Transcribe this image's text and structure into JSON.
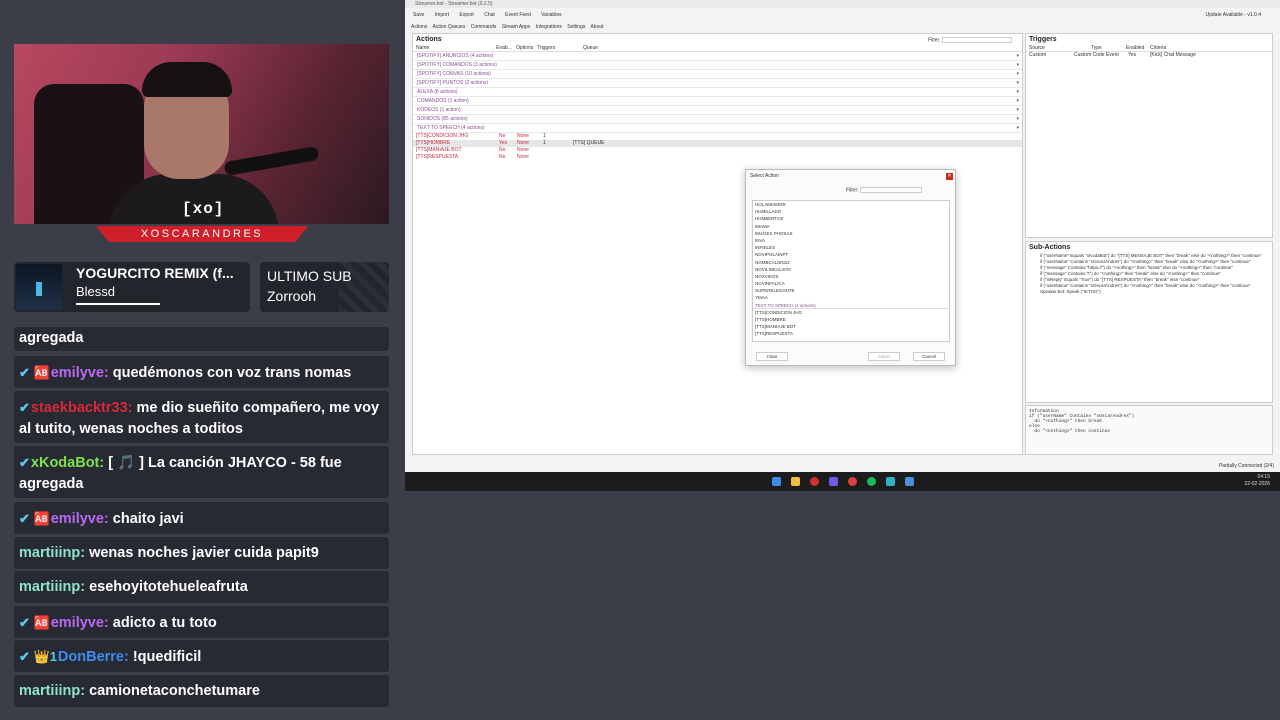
{
  "stream": {
    "channel_name": "XOSCARANDRES",
    "logo_text": "[xo]",
    "song": {
      "title": "YOGURCITO REMIX (f...",
      "artist": "Blessd",
      "progress": 0.5
    },
    "last_sub": {
      "label": "ULTIMO SUB",
      "name": "Zorrooh"
    }
  },
  "chat": [
    {
      "user": "",
      "text": "agregada",
      "icon": "",
      "color": "#ffffff"
    },
    {
      "user": "emilyve:",
      "text": " quedémonos con voz trans nomas",
      "icon": "✔ 🆎",
      "color": "#b86af0"
    },
    {
      "user": "staekbacktr33:",
      "text": " me dio sueñito compañero, me voy al tutito, wenas noches a toditos",
      "icon": "✔",
      "color": "#d8283a"
    },
    {
      "user": "xKodaBot:",
      "text": " [ 🎵 ] La canción JHAYCO - 58 fue agregada",
      "icon": "✔",
      "color": "#7ee24a"
    },
    {
      "user": "emilyve:",
      "text": " chaito javi",
      "icon": "✔ 🆎",
      "color": "#b86af0"
    },
    {
      "user": "martiiinp:",
      "text": " wenas noches javier cuida papit9",
      "icon": "",
      "color": "#8ee3c8"
    },
    {
      "user": "martiiinp:",
      "text": " esehoyitotehueleafruta",
      "icon": "",
      "color": "#8ee3c8"
    },
    {
      "user": "emilyve:",
      "text": " adicto a tu toto",
      "icon": "✔ 🆎",
      "color": "#b86af0"
    },
    {
      "user": "DonBerre:",
      "text": " !quedificil",
      "icon": "✔ 👑1",
      "color": "#3e8bf0"
    },
    {
      "user": "martiiinp:",
      "text": " camionetaconchetumare",
      "icon": "",
      "color": "#8ee3c8"
    }
  ],
  "app": {
    "title": "Streamer.bot - Streamer.bot (0.2.5)",
    "toolbar": [
      "Save",
      "Import",
      "Export",
      "Chat",
      "Event Feed",
      "Variables"
    ],
    "update": "Update Available - v1.0.4",
    "tabs": [
      "Actions",
      "Action Queues",
      "Commands",
      "Stream Apps",
      "Integrations",
      "Settings",
      "About"
    ],
    "actions_title": "Actions",
    "filter_label": "Filter:",
    "columns": [
      "Name",
      "Enab...",
      "Options",
      "Triggers",
      "Queue"
    ],
    "groups": [
      "[SPOTIFY] ANUNCIOS (4 actions)",
      "[SPOTIFY] COMANDOS (3 actions)",
      "[SPOTIFY] CONVAS (10 actions)",
      "[SPOTIFY] PUNTOS (2 actions)",
      "ALEXA (8 actions)",
      "COMANDOS (1 action)",
      "KODEOS (1 action)",
      "SONIDOS (85 actions)",
      "TEXT TO SPEECH (4 actions)"
    ],
    "action_rows": [
      {
        "name": "[TTS]CONDICION JHG",
        "enabled": "No",
        "options": "None",
        "triggers": "1",
        "queue": ""
      },
      {
        "name": "[TTS]HOMBRE",
        "enabled": "Yes",
        "options": "None",
        "triggers": "1",
        "queue": "[TTS] QUEUE"
      },
      {
        "name": "[TTS]MANIAJE BOT",
        "enabled": "No",
        "options": "None",
        "triggers": "",
        "queue": ""
      },
      {
        "name": "[TTS]RESPUESTA",
        "enabled": "No",
        "options": "None",
        "triggers": "",
        "queue": ""
      }
    ],
    "triggers_title": "Triggers",
    "trigger_cols": [
      "Source",
      "Type",
      "Enabled",
      "Criteria"
    ],
    "trigger_row": [
      "Custom",
      "Custom Code Event",
      "Yes",
      "[Kick] Chat Message"
    ],
    "subactions_title": "Sub-Actions",
    "subactions": [
      "if (\"userName\" Equals \"xKodaBot\") do \"[TTS] MENSAJE BOT\" then \"break\" else do \"<nothing>\" then \"continue\"",
      "if (\"userName\" Contains \"xOscarAndres\") do \"<nothing>\" then \"break\" else do \"<nothing>\" then \"continue\"",
      "if (\"message\" Contains \"https://\") do \"<nothing>\" then \"break\" else do \"<nothing>\" then \"continue\"",
      "if (\"message\" Contains \"!\") do \"<nothing>\" then \"break\" else do \"<nothing>\" then \"continue\"",
      "if (\"isReply\" Equals \"True\") do \"[TTS] RESPUESTA\" then \"break\" else \"continue\"",
      "if (\"userName\" Contains \"xOscarAndres\") do \"<nothing>\" then \"break\" else do \"<nothing>\" then \"continue\"",
      "Speaker.bot: Speak (\"IKTOG\")"
    ],
    "info_text": "Information\nif (\"userName\" Contains \"xOscarAndres\")\n  do \"<nothing>\" then break\nelse\n  do \"<nothing>\" then continue",
    "status": "Partially Connected (2/4)"
  },
  "dialog": {
    "title": "Select Action",
    "filter_label": "Filter:",
    "items": [
      "HOLAMIAMOR",
      "HUMILLADO",
      "HUMBERTOZ",
      "IMAMA",
      "IMAGES PHOSAS",
      "INVA",
      "INFIELES",
      "NOVIPOLAINPT",
      "NOMBCALIEN12",
      "NOVILINEALISTA",
      "NOXVIKOS",
      "NOVINFALICA",
      "SUPERELEGANTE",
      "YMAA"
    ],
    "group": "TEXT TO SPEECH (4 actions)",
    "sub_items": [
      "[TTS]CONDICION JHG",
      "[TTS]HOMBRE",
      "[TTS]MANIAJE BOT",
      "[TTS]RESPUESTA"
    ],
    "buttons": [
      "Clear",
      "Select",
      "Cancel"
    ]
  },
  "taskbar": {
    "time": "04:15",
    "date": "22-02-2026"
  }
}
